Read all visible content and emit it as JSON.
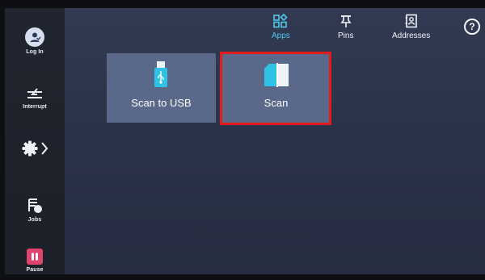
{
  "sidebar": {
    "login_label": "Log In",
    "interrupt_label": "Interrupt",
    "jobs_label": "Jobs",
    "pause_label": "Pause",
    "expand_icon": "chevron-right-icon"
  },
  "topbar": {
    "tabs": [
      {
        "label": "Apps",
        "icon": "apps-grid-icon",
        "active": true
      },
      {
        "label": "Pins",
        "icon": "pin-icon",
        "active": false
      },
      {
        "label": "Addresses",
        "icon": "address-book-icon",
        "active": false
      }
    ],
    "help_glyph": "?"
  },
  "apps": [
    {
      "label": "Scan to USB",
      "icon": "usb-drive-icon"
    },
    {
      "label": "Scan",
      "icon": "scan-document-icon",
      "highlighted": true
    }
  ],
  "colors": {
    "accent": "#53c8ee",
    "highlight": "#e21b1b",
    "pause": "#e0436d",
    "tile": "#5a6889"
  }
}
